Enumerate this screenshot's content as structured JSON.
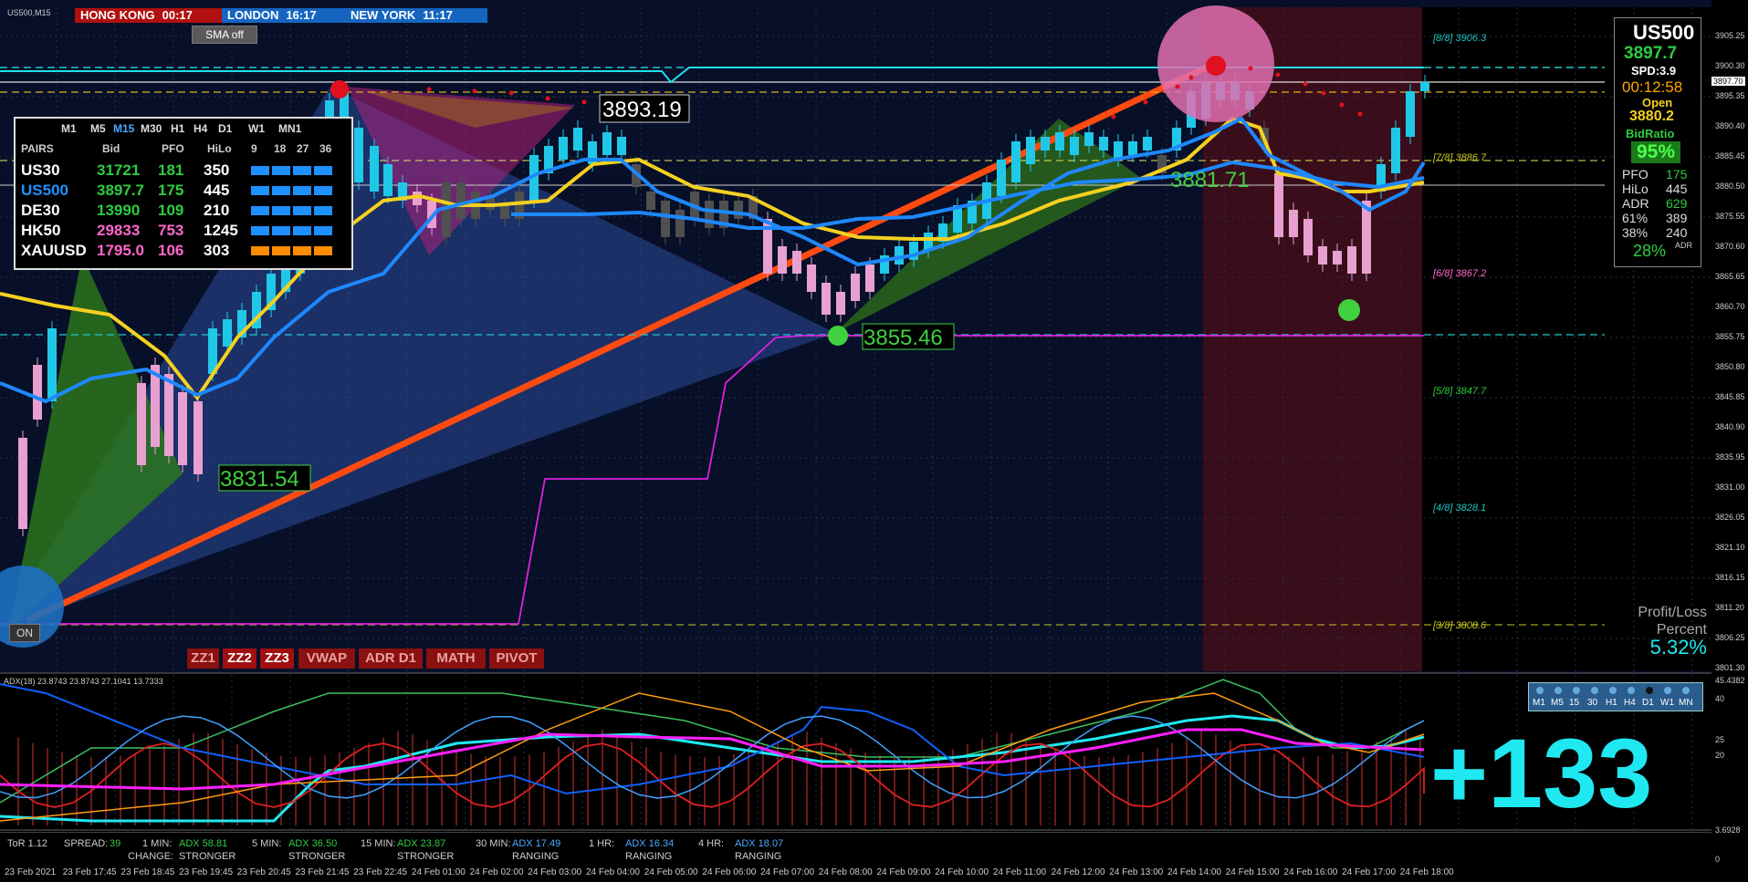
{
  "window": {
    "title": "US500,M15"
  },
  "sessions": [
    {
      "label": "HONG KONG",
      "time": "00:17",
      "color": "#b01010"
    },
    {
      "label": "LONDON",
      "time": "16:17",
      "color": "#1565c0"
    },
    {
      "label": "NEW YORK",
      "time": "11:17",
      "color": "#1565c0"
    }
  ],
  "sma_button": "SMA off",
  "on_button": "ON",
  "pairs_table": {
    "timeframes": [
      "M1",
      "M5",
      "M15",
      "M30",
      "H1",
      "H4",
      "D1",
      "W1",
      "MN1"
    ],
    "headers": [
      "PAIRS",
      "Bid",
      "PFO",
      "HiLo",
      "9",
      "18",
      "27",
      "36"
    ],
    "rows": [
      {
        "pair": "US30",
        "bid": "31721",
        "pfo": "181",
        "hilo": "350",
        "pair_color": "#ffffff",
        "bid_color": "#2ecc40",
        "pfo_color": "#2ecc40",
        "bar_color": "#1e90ff"
      },
      {
        "pair": "US500",
        "bid": "3897.7",
        "pfo": "175",
        "hilo": "445",
        "pair_color": "#1e90ff",
        "bid_color": "#2ecc40",
        "pfo_color": "#2ecc40",
        "bar_color": "#1e90ff"
      },
      {
        "pair": "DE30",
        "bid": "13990",
        "pfo": "109",
        "hilo": "210",
        "pair_color": "#ffffff",
        "bid_color": "#2ecc40",
        "pfo_color": "#2ecc40",
        "bar_color": "#1e90ff"
      },
      {
        "pair": "HK50",
        "bid": "29833",
        "pfo": "753",
        "hilo": "1245",
        "pair_color": "#ffffff",
        "bid_color": "#ff66cc",
        "pfo_color": "#ff66cc",
        "bar_color": "#1e90ff"
      },
      {
        "pair": "XAUUSD",
        "bid": "1795.0",
        "pfo": "106",
        "hilo": "303",
        "pair_color": "#ffffff",
        "bid_color": "#ff66cc",
        "pfo_color": "#ff66cc",
        "bar_color": "#ff8c00"
      }
    ]
  },
  "price_labels": {
    "top": "3893.19",
    "mid": "3855.46",
    "low": "3831.54",
    "right": "3881.71"
  },
  "murrey_levels": [
    {
      "label": "[8/8]",
      "value": "3906.3",
      "color": "#20c0c0"
    },
    {
      "label": "[7/8]",
      "value": "3886.7",
      "color": "#c8c820"
    },
    {
      "label": "[6/8]",
      "value": "3867.2",
      "color": "#ff66cc"
    },
    {
      "label": "[5/8]",
      "value": "3847.7",
      "color": "#2ecc40"
    },
    {
      "label": "[4/8]",
      "value": "3828.1",
      "color": "#20c0c0"
    },
    {
      "label": "[3/8]",
      "value": "3808.6",
      "color": "#c8c820"
    }
  ],
  "info_panel": {
    "symbol": "US500",
    "price": "3897.7",
    "spread": "SPD:3.9",
    "timer": "00:12:58",
    "open_label": "Open",
    "open_value": "3880.2",
    "bidratio_label": "BidRatio",
    "bidratio_value": "95%",
    "stats": [
      {
        "label": "PFO",
        "value": "175",
        "color": "#2ecc40"
      },
      {
        "label": "HiLo",
        "value": "445",
        "color": "#dddddd"
      },
      {
        "label": "ADR",
        "value": "629",
        "color": "#2ecc40"
      },
      {
        "label": "61%",
        "value": "389",
        "color": "#dddddd"
      },
      {
        "label": "38%",
        "value": "240",
        "color": "#dddddd"
      }
    ],
    "adr_pct": "28%",
    "adr_small": "ADR"
  },
  "profit_loss": {
    "line1": "Profit/Loss",
    "line2": "Percent",
    "value": "5.32%"
  },
  "bottom_buttons": [
    "ZZ1",
    "ZZ2",
    "ZZ3",
    "VWAP",
    "ADR D1",
    "MATH",
    "PIVOT"
  ],
  "adx_header": "ADX(18) 23.8743 23.8743 27.1041 13.7333",
  "big_number": "+133",
  "tf_strip": [
    "M1",
    "M5",
    "15",
    "30",
    "H1",
    "H4",
    "D1",
    "W1",
    "MN"
  ],
  "status_bar": {
    "tor": "ToR 1.12",
    "spread_label": "SPREAD:",
    "spread_value": "39",
    "items": [
      {
        "tf": "1 MIN:",
        "adx": "ADX 58.81",
        "state": "STRONGER",
        "color": "#2ecc40"
      },
      {
        "tf": "5 MIN:",
        "adx": "ADX 36.50",
        "state": "STRONGER",
        "color": "#2ecc40"
      },
      {
        "tf": "15 MIN:",
        "adx": "ADX 23.87",
        "state": "STRONGER",
        "color": "#2ecc40"
      },
      {
        "tf": "30 MIN:",
        "adx": "ADX 17.49",
        "state": "RANGING",
        "color": "#4aa8ff"
      },
      {
        "tf": "1 HR:",
        "adx": "ADX 16.34",
        "state": "RANGING",
        "color": "#4aa8ff"
      },
      {
        "tf": "4 HR:",
        "adx": "ADX 18.07",
        "state": "RANGING",
        "color": "#4aa8ff"
      }
    ],
    "change_label": "CHANGE:"
  },
  "y_axis_labels": [
    "3905.25",
    "3900.30",
    "3895.35",
    "3890.40",
    "3885.45",
    "3880.50",
    "3875.55",
    "3870.60",
    "3865.65",
    "3860.70",
    "3855.75",
    "3850.80",
    "3845.85",
    "3840.90",
    "3835.95",
    "3831.00",
    "3826.05",
    "3821.10",
    "3816.15",
    "3811.20",
    "3806.25",
    "3801.30"
  ],
  "y_axis_price_box": "3897.70",
  "adx_axis_labels": [
    "45.4382",
    "40",
    "25",
    "20",
    "3.6928",
    "0"
  ],
  "x_axis_labels": [
    "23 Feb 2021",
    "23 Feb 17:45",
    "23 Feb 18:45",
    "23 Feb 19:45",
    "23 Feb 20:45",
    "23 Feb 21:45",
    "23 Feb 22:45",
    "24 Feb 01:00",
    "24 Feb 02:00",
    "24 Feb 03:00",
    "24 Feb 04:00",
    "24 Feb 05:00",
    "24 Feb 06:00",
    "24 Feb 07:00",
    "24 Feb 08:00",
    "24 Feb 09:00",
    "24 Feb 10:00",
    "24 Feb 11:00",
    "24 Feb 12:00",
    "24 Feb 13:00",
    "24 Feb 14:00",
    "24 Feb 15:00",
    "24 Feb 16:00",
    "24 Feb 17:00",
    "24 Feb 18:00"
  ]
}
